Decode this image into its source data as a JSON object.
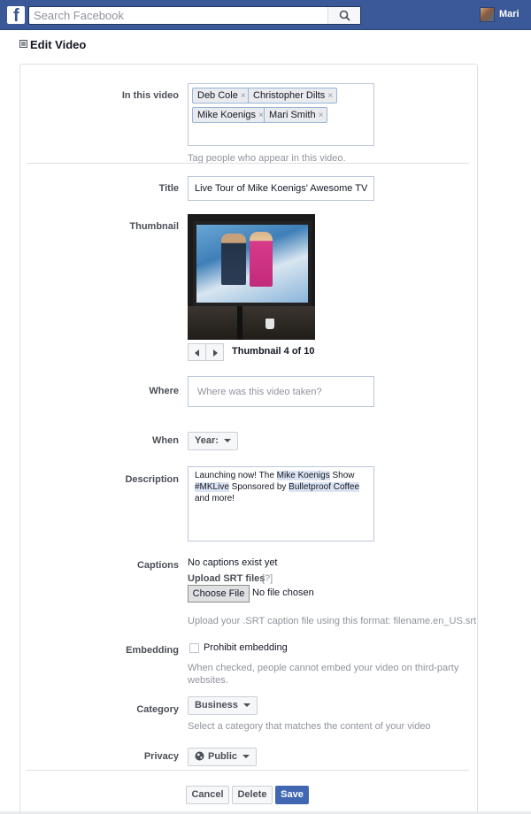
{
  "topbar": {
    "logo": "f",
    "search_placeholder": "Search Facebook",
    "user_name": "Mari"
  },
  "page": {
    "title": "Edit Video"
  },
  "tags": {
    "label": "In this video",
    "people": [
      "Deb Cole",
      "Christopher Dilts",
      "Mike Koenigs",
      "Mari Smith"
    ],
    "remove_glyph": "×",
    "hint": "Tag people who appear in this video."
  },
  "title_field": {
    "label": "Title",
    "value": "Live Tour of Mike Koenigs' Awesome TV Stu"
  },
  "thumbnail": {
    "label": "Thumbnail",
    "pager_text": "Thumbnail 4 of 10",
    "current": 4,
    "total": 10
  },
  "where": {
    "label": "Where",
    "placeholder": "Where was this video taken?"
  },
  "when": {
    "label": "When",
    "select_value": "Year:"
  },
  "description": {
    "label": "Description",
    "text_1": "Launching now! The ",
    "mention_1": "Mike Koenigs",
    "text_2": " Show",
    "mention_2": "#MKLive",
    "text_3": " Sponsored by ",
    "mention_3": "Bulletproof Coffee",
    "text_4": " and more!"
  },
  "captions": {
    "label": "Captions",
    "status": "No captions exist yet",
    "upload_label": "Upload SRT files",
    "help_link": "[?]",
    "choose_file": "Choose File",
    "no_file": "No file chosen",
    "format_hint": "Upload your .SRT caption file using this format: filename.en_US.srt"
  },
  "embedding": {
    "label": "Embedding",
    "checkbox_label": "Prohibit embedding",
    "checked": false,
    "hint_line1": "When checked, people cannot embed your video on third-party",
    "hint_line2": "websites."
  },
  "category": {
    "label": "Category",
    "select_value": "Business",
    "hint": "Select a category that matches the content of your video"
  },
  "privacy": {
    "label": "Privacy",
    "select_value": "Public"
  },
  "actions": {
    "cancel": "Cancel",
    "delete": "Delete",
    "save": "Save"
  },
  "colors": {
    "brand_blue": "#3b5998",
    "primary_button": "#4267b2",
    "mention_highlight": "#dce4f3"
  }
}
